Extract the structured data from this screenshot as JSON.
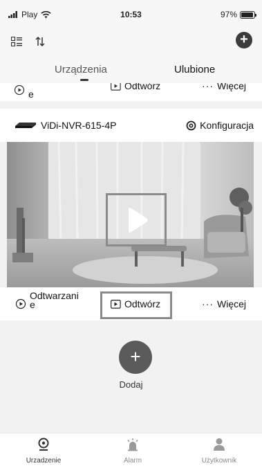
{
  "status_bar": {
    "carrier": "Play",
    "time": "10:53",
    "battery": "97%",
    "battery_level": 0.97
  },
  "toolbar": {
    "list_icon": "list-view-icon",
    "sort_icon": "sort-arrows-icon",
    "add_icon": "plus-icon"
  },
  "tabs": {
    "devices": "Urządzenia",
    "favorites": "Ulubione"
  },
  "partial_card": {
    "playback_label": "e",
    "play_label": "Odtwórz",
    "more_label": "Więcej"
  },
  "device": {
    "name": "ViDi-NVR-615-4P",
    "config_label": "Konfiguracja"
  },
  "actions": {
    "playback_label": "Odtwarzani\ne",
    "play_label": "Odtwórz",
    "more_label": "Więcej"
  },
  "add": {
    "label": "Dodaj"
  },
  "bottom_nav": [
    {
      "label": "Urzadzenie",
      "icon": "camera-icon"
    },
    {
      "label": "Alarm",
      "icon": "alarm-icon"
    },
    {
      "label": "Użytkownik",
      "icon": "user-icon"
    }
  ]
}
